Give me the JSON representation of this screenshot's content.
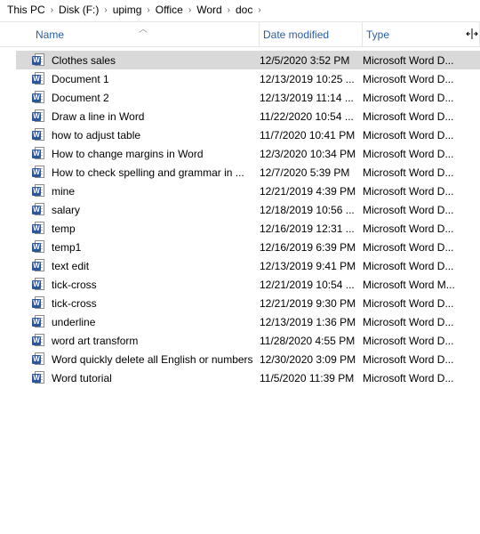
{
  "breadcrumb": [
    "This PC",
    "Disk (F:)",
    "upimg",
    "Office",
    "Word",
    "doc"
  ],
  "columns": {
    "name": "Name",
    "date": "Date modified",
    "type": "Type"
  },
  "files": [
    {
      "name": "Clothes sales",
      "date": "12/5/2020 3:52 PM",
      "type": "Microsoft Word D...",
      "selected": true
    },
    {
      "name": "Document 1",
      "date": "12/13/2019 10:25 ...",
      "type": "Microsoft Word D..."
    },
    {
      "name": "Document 2",
      "date": "12/13/2019 11:14 ...",
      "type": "Microsoft Word D..."
    },
    {
      "name": "Draw a line in Word",
      "date": "11/22/2020 10:54 ...",
      "type": "Microsoft Word D..."
    },
    {
      "name": "how to adjust table",
      "date": "11/7/2020 10:41 PM",
      "type": "Microsoft Word D..."
    },
    {
      "name": "How to change margins in Word",
      "date": "12/3/2020 10:34 PM",
      "type": "Microsoft Word D..."
    },
    {
      "name": "How to check spelling and grammar in ...",
      "date": "12/7/2020 5:39 PM",
      "type": "Microsoft Word D..."
    },
    {
      "name": "mine",
      "date": "12/21/2019 4:39 PM",
      "type": "Microsoft Word D..."
    },
    {
      "name": "salary",
      "date": "12/18/2019 10:56 ...",
      "type": "Microsoft Word D..."
    },
    {
      "name": "temp",
      "date": "12/16/2019 12:31 ...",
      "type": "Microsoft Word D..."
    },
    {
      "name": "temp1",
      "date": "12/16/2019 6:39 PM",
      "type": "Microsoft Word D..."
    },
    {
      "name": "text edit",
      "date": "12/13/2019 9:41 PM",
      "type": "Microsoft Word D..."
    },
    {
      "name": "tick-cross",
      "date": "12/21/2019 10:54 ...",
      "type": "Microsoft Word M..."
    },
    {
      "name": "tick-cross",
      "date": "12/21/2019 9:30 PM",
      "type": "Microsoft Word D..."
    },
    {
      "name": "underline",
      "date": "12/13/2019 1:36 PM",
      "type": "Microsoft Word D..."
    },
    {
      "name": "word art transform",
      "date": "11/28/2020 4:55 PM",
      "type": "Microsoft Word D..."
    },
    {
      "name": "Word quickly delete all English or numbers",
      "date": "12/30/2020 3:09 PM",
      "type": "Microsoft Word D..."
    },
    {
      "name": "Word tutorial",
      "date": "11/5/2020 11:39 PM",
      "type": "Microsoft Word D..."
    }
  ]
}
